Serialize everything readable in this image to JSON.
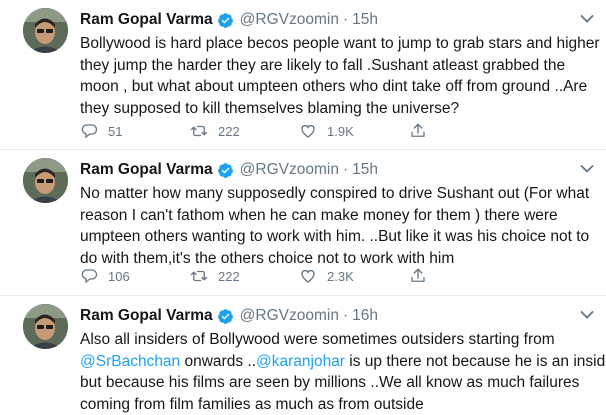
{
  "tweets": [
    {
      "name": "Ram Gopal Varma",
      "handle": "@RGVzoomin",
      "dot": "·",
      "time": "15h",
      "lines": [
        "Bollywood is hard place becos people want to jump to grab stars and higher",
        "they jump the harder they are likely to fall .Sushant atleast grabbed the",
        "moon , but what about umpteen others who dint take off from ground  ..Are",
        "they supposed to kill themselves blaming the universe?"
      ],
      "replies": "51",
      "retweets": "222",
      "likes": "1.9K"
    },
    {
      "name": "Ram Gopal Varma",
      "handle": "@RGVzoomin",
      "dot": "·",
      "time": "15h",
      "lines": [
        "No matter how many supposedly conspired to drive Sushant out (For what",
        "reason I can't fathom when he can make money for them ) there were",
        "umpteen others wanting to work with him. ..But like it was his choice not to",
        "do with them,it's the others choice not to work with him"
      ],
      "replies": "106",
      "retweets": "222",
      "likes": "2.3K"
    },
    {
      "name": "Ram Gopal Varma",
      "handle": "@RGVzoomin",
      "dot": "·",
      "time": "16h",
      "line1": "Also all insiders of Bollywood were sometimes outsiders starting from",
      "mention1": "@SrBachchan",
      "line2_mid": " onwards ..",
      "mention2": "@karanjohar",
      "line2_end": " is up there not because he is an insider",
      "line3": "but because his films are seen by millions ..We all know as much failures",
      "line4": "coming from film families as much as from outside"
    }
  ],
  "colors": {
    "accent": "#1da1f2",
    "text": "#14171a",
    "muted": "#657786",
    "divider": "#e6ecf0"
  },
  "icons": [
    "verified-badge-icon",
    "chevron-down-icon",
    "reply-icon",
    "retweet-icon",
    "like-icon",
    "share-icon"
  ]
}
